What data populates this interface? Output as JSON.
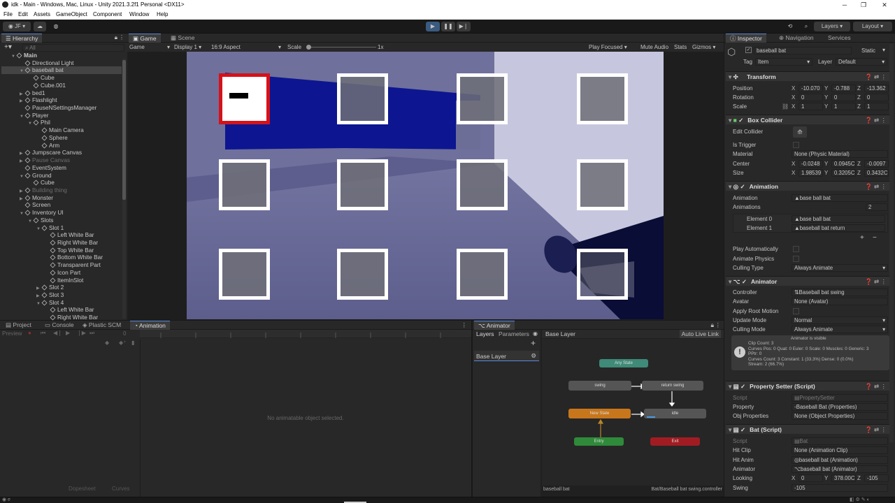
{
  "window": {
    "title": "idk - Main - Windows, Mac, Linux - Unity 2021.3.2f1 Personal <DX11>"
  },
  "menu": [
    "File",
    "Edit",
    "Assets",
    "GameObject",
    "Component",
    "Window",
    "Help"
  ],
  "toolbar": {
    "account": "JF",
    "layers": "Layers",
    "layout": "Layout"
  },
  "hierarchy": {
    "tab": "Hierarchy",
    "search_placeholder": "All",
    "rows": [
      {
        "label": "Main",
        "depth": 0,
        "arrow": "▼",
        "dim": false,
        "sel": false,
        "root": true
      },
      {
        "label": "Directional Light",
        "depth": 1,
        "arrow": "",
        "dim": false,
        "sel": false
      },
      {
        "label": "baseball bat",
        "depth": 1,
        "arrow": "▼",
        "dim": false,
        "sel": true
      },
      {
        "label": "Cube",
        "depth": 2,
        "arrow": "",
        "dim": false,
        "sel": false
      },
      {
        "label": "Cube.001",
        "depth": 2,
        "arrow": "",
        "dim": false,
        "sel": false
      },
      {
        "label": "bed1",
        "depth": 1,
        "arrow": "▶",
        "dim": false,
        "sel": false
      },
      {
        "label": "Flashlight",
        "depth": 1,
        "arrow": "▶",
        "dim": false,
        "sel": false
      },
      {
        "label": "PauseNSettingsManager",
        "depth": 1,
        "arrow": "",
        "dim": false,
        "sel": false
      },
      {
        "label": "Player",
        "depth": 1,
        "arrow": "▼",
        "dim": false,
        "sel": false
      },
      {
        "label": "Phil",
        "depth": 2,
        "arrow": "▼",
        "dim": false,
        "sel": false
      },
      {
        "label": "Main Camera",
        "depth": 3,
        "arrow": "",
        "dim": false,
        "sel": false
      },
      {
        "label": "Sphere",
        "depth": 3,
        "arrow": "",
        "dim": false,
        "sel": false
      },
      {
        "label": "Arm",
        "depth": 3,
        "arrow": "",
        "dim": false,
        "sel": false
      },
      {
        "label": "Jumpscare Canvas",
        "depth": 1,
        "arrow": "▶",
        "dim": false,
        "sel": false
      },
      {
        "label": "Pause Canvas",
        "depth": 1,
        "arrow": "▶",
        "dim": true,
        "sel": false
      },
      {
        "label": "EventSystem",
        "depth": 1,
        "arrow": "",
        "dim": false,
        "sel": false
      },
      {
        "label": "Ground",
        "depth": 1,
        "arrow": "▼",
        "dim": false,
        "sel": false
      },
      {
        "label": "Cube",
        "depth": 2,
        "arrow": "",
        "dim": false,
        "sel": false
      },
      {
        "label": "Building thing",
        "depth": 1,
        "arrow": "▶",
        "dim": true,
        "sel": false
      },
      {
        "label": "Monster",
        "depth": 1,
        "arrow": "▶",
        "dim": false,
        "sel": false
      },
      {
        "label": "Screen",
        "depth": 1,
        "arrow": "",
        "dim": false,
        "sel": false
      },
      {
        "label": "Inventory UI",
        "depth": 1,
        "arrow": "▼",
        "dim": false,
        "sel": false
      },
      {
        "label": "Slots",
        "depth": 2,
        "arrow": "▼",
        "dim": false,
        "sel": false
      },
      {
        "label": "Slot 1",
        "depth": 3,
        "arrow": "▼",
        "dim": false,
        "sel": false
      },
      {
        "label": "Left White Bar",
        "depth": 4,
        "arrow": "",
        "dim": false,
        "sel": false
      },
      {
        "label": "Right White Bar",
        "depth": 4,
        "arrow": "",
        "dim": false,
        "sel": false
      },
      {
        "label": "Top White Bar",
        "depth": 4,
        "arrow": "",
        "dim": false,
        "sel": false
      },
      {
        "label": "Bottom White Bar",
        "depth": 4,
        "arrow": "",
        "dim": false,
        "sel": false
      },
      {
        "label": "Transparent Part",
        "depth": 4,
        "arrow": "",
        "dim": false,
        "sel": false
      },
      {
        "label": "Icon Part",
        "depth": 4,
        "arrow": "",
        "dim": false,
        "sel": false
      },
      {
        "label": "ItemInSlot",
        "depth": 4,
        "arrow": "",
        "dim": false,
        "sel": false
      },
      {
        "label": "Slot 2",
        "depth": 3,
        "arrow": "▶",
        "dim": false,
        "sel": false
      },
      {
        "label": "Slot 3",
        "depth": 3,
        "arrow": "▶",
        "dim": false,
        "sel": false
      },
      {
        "label": "Slot 4",
        "depth": 3,
        "arrow": "▼",
        "dim": false,
        "sel": false
      },
      {
        "label": "Left White Bar",
        "depth": 4,
        "arrow": "",
        "dim": false,
        "sel": false
      },
      {
        "label": "Right White Bar",
        "depth": 4,
        "arrow": "",
        "dim": false,
        "sel": false
      }
    ]
  },
  "game": {
    "tab_game": "Game",
    "tab_scene": "Scene",
    "mode": "Game",
    "display": "Display 1",
    "aspect": "16:9 Aspect",
    "scale_label": "Scale",
    "scale_value": "1x",
    "play_focused": "Play Focused",
    "mute": "Mute Audio",
    "stats": "Stats",
    "gizmos": "Gizmos"
  },
  "bottom": {
    "tabs": [
      "Project",
      "Console",
      "Plastic SCM",
      "Animation"
    ],
    "preview": "Preview",
    "empty_msg": "No animatable object selected.",
    "dopesheet": "Dopesheet",
    "curves": "Curves"
  },
  "animator": {
    "tab": "Animator",
    "subtabs": [
      "Layers",
      "Parameters"
    ],
    "crumb": "Base Layer",
    "auto_live": "Auto Live Link",
    "layer_item": "Base Layer",
    "nodes": {
      "any": "Any State",
      "swing": "swing",
      "return": "return swing",
      "new": "New State",
      "idle": "idle",
      "entry": "Entry",
      "exit": "Exit"
    },
    "footer_left": "baseball bat",
    "footer_right": "Bat/Baseball bat swing.controller"
  },
  "inspector": {
    "tabs": [
      "Inspector",
      "Navigation",
      "Services"
    ],
    "object_name": "baseball bat",
    "static": "Static",
    "tag_label": "Tag",
    "tag": "Item",
    "layer_label": "Layer",
    "layer": "Default",
    "transform": {
      "title": "Transform",
      "position": [
        "-10.070",
        "-0.788",
        "-13.362"
      ],
      "rotation": [
        "0",
        "0",
        "0"
      ],
      "scale": [
        "1",
        "1",
        "1"
      ]
    },
    "box": {
      "title": "Box Collider",
      "edit": "Edit Collider",
      "trigger": "Is Trigger",
      "material_label": "Material",
      "material": "None (Physic Material)",
      "center": [
        "-0.0248",
        "0.0945C",
        "-0.0097"
      ],
      "size": [
        "1.98539",
        "0.3205C",
        "0.3432C"
      ]
    },
    "animation": {
      "title": "Animation",
      "anim_label": "Animation",
      "anim": "base ball bat",
      "anims_label": "Animations",
      "count": "2",
      "el0_label": "Element 0",
      "el0": "base ball bat",
      "el1_label": "Element 1",
      "el1": "baseball bat return",
      "play_auto": "Play Automatically",
      "physics": "Animate Physics",
      "culling_label": "Culling Type",
      "culling": "Always Animate"
    },
    "animator": {
      "title": "Animator",
      "controller_label": "Controller",
      "controller": "Baseball bat swing",
      "avatar_label": "Avatar",
      "avatar": "None (Avatar)",
      "root_motion": "Apply Root Motion",
      "update_label": "Update Mode",
      "update": "Normal",
      "culling_label": "Culling Mode",
      "culling": "Always Animate",
      "info": [
        "Animator is visible",
        "Clip Count: 3",
        "Curves Pos: 0 Quat: 0 Euler: 0 Scale: 0 Muscles: 0 Generic: 3",
        "PPtr: 0",
        "Curves Count: 3 Constant: 1 (33.3%) Dense: 0 (0.0%)",
        "Stream: 2 (66.7%)"
      ]
    },
    "prop_setter": {
      "title": "Property Setter (Script)",
      "script_label": "Script",
      "script": "PropertySetter",
      "property_label": "Property",
      "property": "Baseball Bat (Properties)",
      "obj_label": "Obj Properties",
      "obj": "None (Object Properties)"
    },
    "bat": {
      "title": "Bat (Script)",
      "script_label": "Script",
      "script": "Bat",
      "hit_clip_label": "Hit Clip",
      "hit_clip": "None (Animation Clip)",
      "hit_anim_label": "Hit Anim",
      "hit_anim": "baseball bat (Animation)",
      "animator_label": "Animator",
      "animator": "baseball bat (Animator)",
      "looking_label": "Looking",
      "looking": [
        "0",
        "378.00C",
        "-105"
      ],
      "swing_label": "Swing",
      "swing": "-105"
    }
  }
}
